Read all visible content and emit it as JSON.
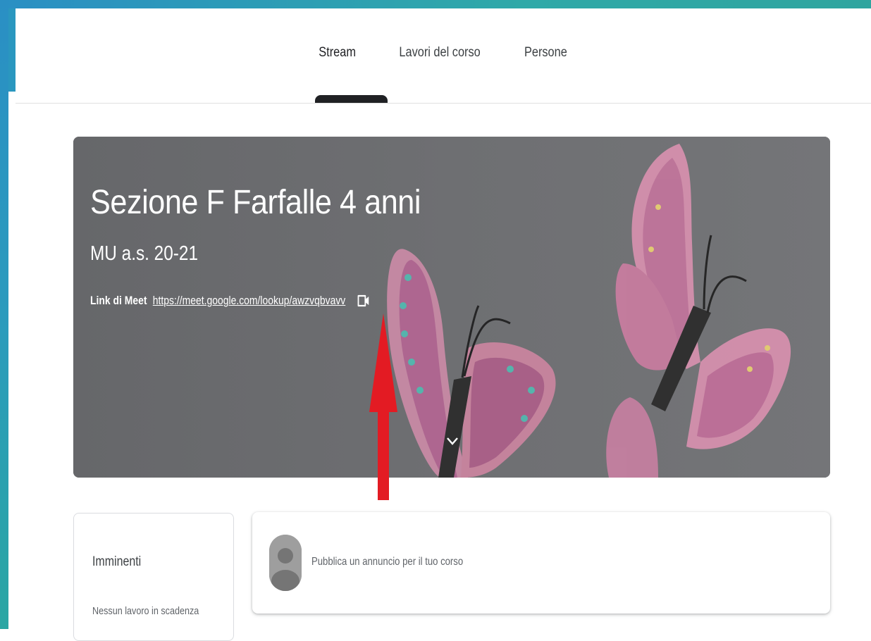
{
  "nav": {
    "tabs": [
      {
        "label": "Stream"
      },
      {
        "label": "Lavori del corso"
      },
      {
        "label": "Persone"
      }
    ]
  },
  "banner": {
    "title": "Sezione F Farfalle 4 anni",
    "subtitle": "MU a.s. 20-21",
    "meet_label": "Link di Meet",
    "meet_url": "https://meet.google.com/lookup/awzvqbvavv"
  },
  "upcoming": {
    "title": "Imminenti",
    "empty_text": "Nessun lavoro in scadenza"
  },
  "announce": {
    "placeholder": "Pubblica un annuncio per il tuo corso"
  },
  "colors": {
    "frame": "#2a97bf",
    "banner_bg": "#6a6b6e",
    "annotation_arrow": "#e31b23"
  },
  "icons": {
    "meet": "video-camera-icon",
    "expand": "chevron-down-icon",
    "avatar": "user-avatar-icon"
  }
}
